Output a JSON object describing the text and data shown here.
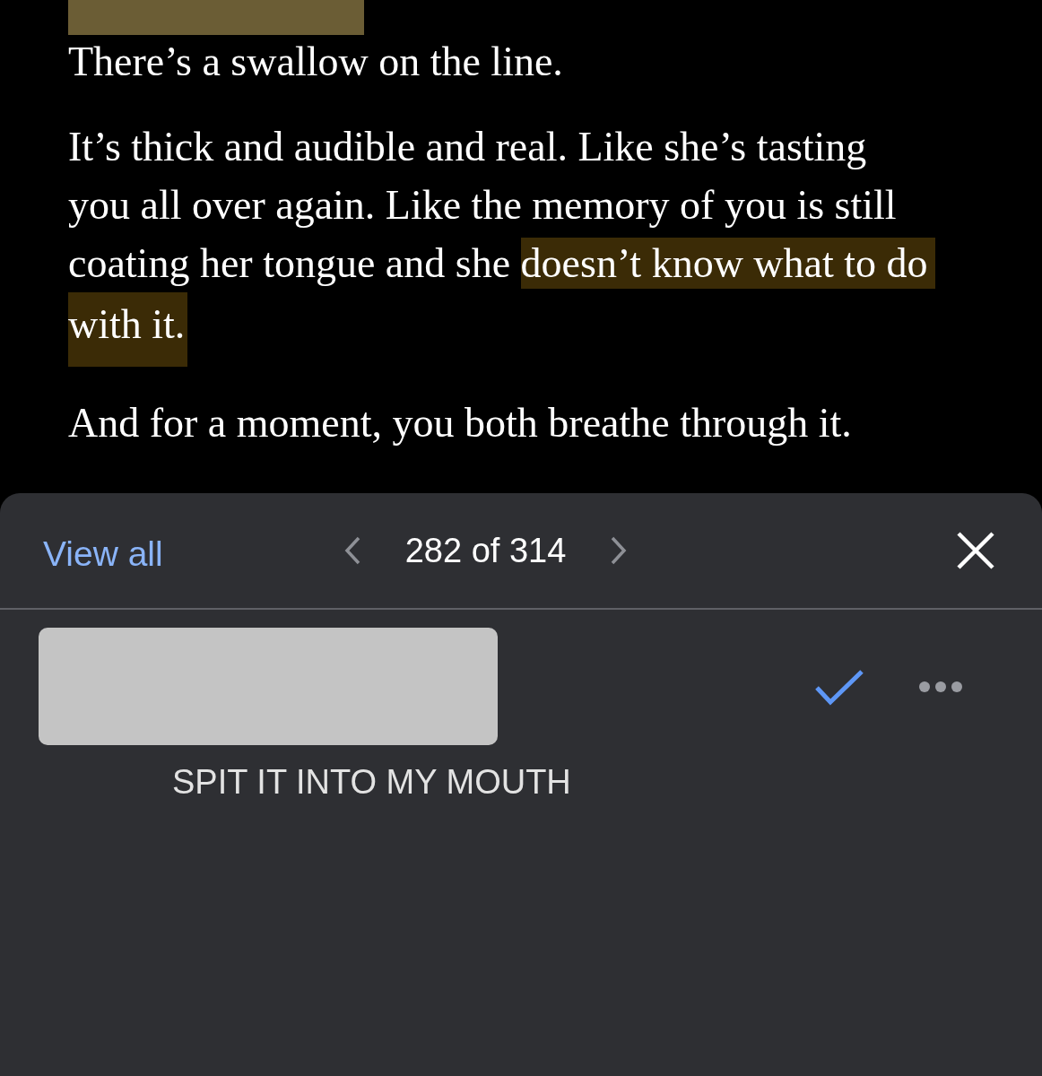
{
  "document": {
    "paragraphs": [
      {
        "lines": [
          [
            {
              "text": "There’s a swallow on the line.",
              "highlighted": false
            }
          ]
        ]
      },
      {
        "lines": [
          [
            {
              "text": "It’s thick and audible and real. Like she’s tasting",
              "highlighted": false
            }
          ],
          [
            {
              "text": "you all over again. Like the memory of you is still",
              "highlighted": false
            }
          ],
          [
            {
              "text": "coating her tongue and she ",
              "highlighted": false
            },
            {
              "text": "doesn’t know what to do",
              "highlighted": true
            }
          ],
          [
            {
              "text": "with it.",
              "highlighted": true
            }
          ]
        ]
      },
      {
        "lines": [
          [
            {
              "text": "And for a moment, you both breathe through it.",
              "highlighted": false
            }
          ]
        ]
      }
    ]
  },
  "comments_panel": {
    "view_all": "View all",
    "counter": "282 of 314",
    "comment": {
      "text": "SPIT IT INTO MY MOUTH",
      "resolved": false
    }
  }
}
